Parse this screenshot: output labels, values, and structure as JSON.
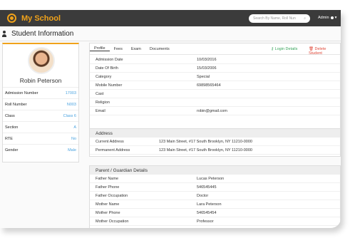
{
  "app": {
    "title": "My School"
  },
  "topbar": {
    "search_placeholder": "Search By Name, Roll Nun",
    "user_label": "Admin"
  },
  "page": {
    "title": "Student Information"
  },
  "profile": {
    "name": "Robin Peterson",
    "fields": [
      {
        "label": "Admission Number",
        "value": "17003"
      },
      {
        "label": "Roll Number",
        "value": "N003"
      },
      {
        "label": "Class",
        "value": "Class 6"
      },
      {
        "label": "Section",
        "value": "A"
      },
      {
        "label": "RTE",
        "value": "No"
      },
      {
        "label": "Gender",
        "value": "Male"
      }
    ]
  },
  "tabs": [
    {
      "label": "Profile"
    },
    {
      "label": "Fees"
    },
    {
      "label": "Exam"
    },
    {
      "label": "Documents"
    }
  ],
  "actions": {
    "login_details": "Login Details",
    "delete_student": "Delete Student"
  },
  "details": [
    {
      "label": "Admission Date",
      "value": "10/03/2016"
    },
    {
      "label": "Date Of Birth",
      "value": "15/03/2006"
    },
    {
      "label": "Category",
      "value": "Special"
    },
    {
      "label": "Mobile Number",
      "value": "69898565464"
    },
    {
      "label": "Cast",
      "value": ""
    },
    {
      "label": "Religion",
      "value": ""
    },
    {
      "label": "Email",
      "value": "robin@gmail.com"
    }
  ],
  "address": {
    "title": "Address",
    "rows": [
      {
        "label": "Current Address",
        "value": "123 Main Street, #17 South Brooklyn, NY 11210-0000"
      },
      {
        "label": "Permanent Address",
        "value": "123 Main Street, #17 South Brooklyn, NY 11210-0000"
      }
    ]
  },
  "guardian": {
    "title": "Parent / Guardian Details",
    "rows": [
      {
        "label": "Father Name",
        "value": "Lucas Peterson"
      },
      {
        "label": "Father Phone",
        "value": "546545445"
      },
      {
        "label": "Father Occupation",
        "value": "Doctor"
      },
      {
        "label": "Mother Name",
        "value": "Lara Peterson"
      },
      {
        "label": "Mother Phone",
        "value": "546545454"
      },
      {
        "label": "Mother Occupation",
        "value": "Professor"
      }
    ]
  },
  "colors": {
    "brand": "#f0a21a",
    "topbar": "#3b3b3b",
    "link": "#4aa3e0",
    "success": "#3aa55c",
    "danger": "#e04a3a"
  }
}
